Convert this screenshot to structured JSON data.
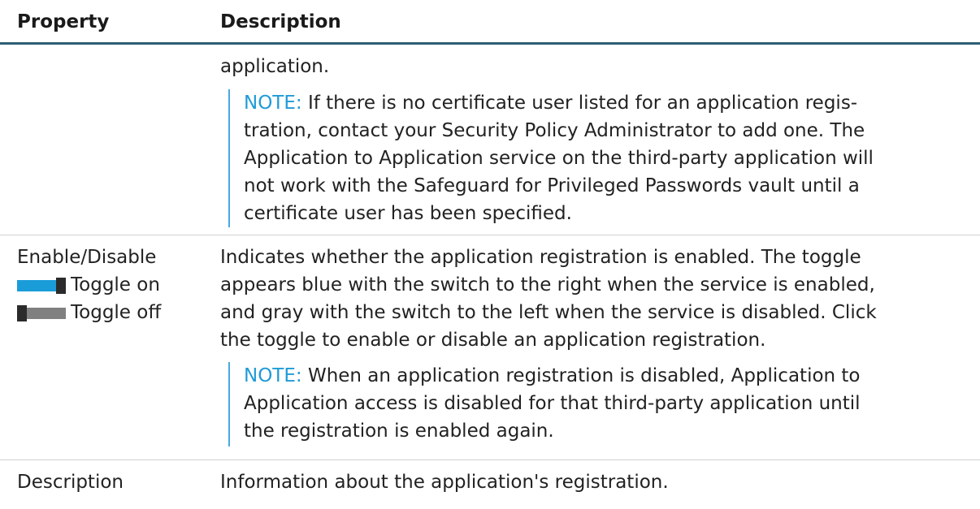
{
  "columns": {
    "property": "Property",
    "description": "Description"
  },
  "rows": [
    {
      "property": "",
      "description": "application.",
      "note": {
        "label": "NOTE:",
        "lines": [
          " If there is no certificate user listed for an application regis-",
          "tration, contact your Security Policy Administrator to add one. The",
          "Application to Application service on the third-party application will",
          "not work with the Safeguard for Privileged Passwords vault until a",
          "certificate user has been specified."
        ]
      }
    },
    {
      "property": "Enable/Disable",
      "toggles": [
        {
          "label": "Toggle on",
          "state": "on",
          "color": "#1a9cd8"
        },
        {
          "label": "Toggle off",
          "state": "off",
          "color": "#808080"
        }
      ],
      "description_lines": [
        "Indicates whether the application registration is enabled. The toggle",
        "appears blue with the switch to the right when the service is enabled,",
        "and gray with the switch to the left when the service is disabled. Click",
        "the toggle to enable or disable an application registration."
      ],
      "note": {
        "label": "NOTE:",
        "lines": [
          " When an application registration is disabled, Application to",
          "Application access is disabled for that third-party application until",
          "the registration is enabled again."
        ]
      }
    },
    {
      "property": "Description",
      "description": "Information about the application's registration."
    }
  ],
  "colors": {
    "header_rule": "#2d5f73",
    "note_accent": "#1f9bd7",
    "note_bar": "#48a9e0"
  }
}
